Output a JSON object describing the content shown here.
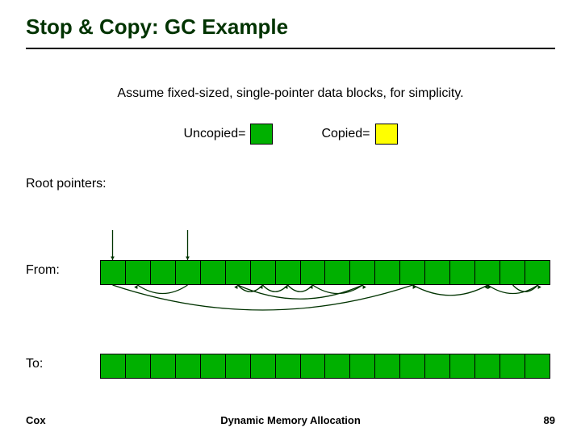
{
  "title": "Stop & Copy: GC Example",
  "assume": "Assume fixed-sized, single-pointer data blocks, for simplicity.",
  "legend": {
    "uncopied_label": "Uncopied=",
    "copied_label": "Copied=",
    "colors": {
      "uncopied": "#00b000",
      "copied": "#ffff00"
    }
  },
  "labels": {
    "roots": "Root pointers:",
    "from": "From:",
    "to": "To:"
  },
  "bars": {
    "cells_per_bar": 18,
    "from_cells": 18,
    "to_cells": 18
  },
  "root_pointers": [
    {
      "from_root": true,
      "to_cell": 0
    },
    {
      "from_root": true,
      "to_cell": 3
    }
  ],
  "pointers": [
    {
      "from_cell": 3,
      "to_cell": 1
    },
    {
      "from_cell": 6,
      "to_cell": 5
    },
    {
      "from_cell": 7,
      "to_cell": 6
    },
    {
      "from_cell": 8,
      "to_cell": 7
    },
    {
      "from_cell": 10,
      "to_cell": 8
    },
    {
      "from_cell": 5,
      "to_cell": 10
    },
    {
      "from_cell": 0,
      "to_cell": 12
    },
    {
      "from_cell": 12,
      "to_cell": 15
    },
    {
      "from_cell": 17,
      "to_cell": 15
    },
    {
      "from_cell": 16,
      "to_cell": 17
    }
  ],
  "footer": {
    "left": "Cox",
    "center": "Dynamic Memory Allocation",
    "right": "89"
  }
}
